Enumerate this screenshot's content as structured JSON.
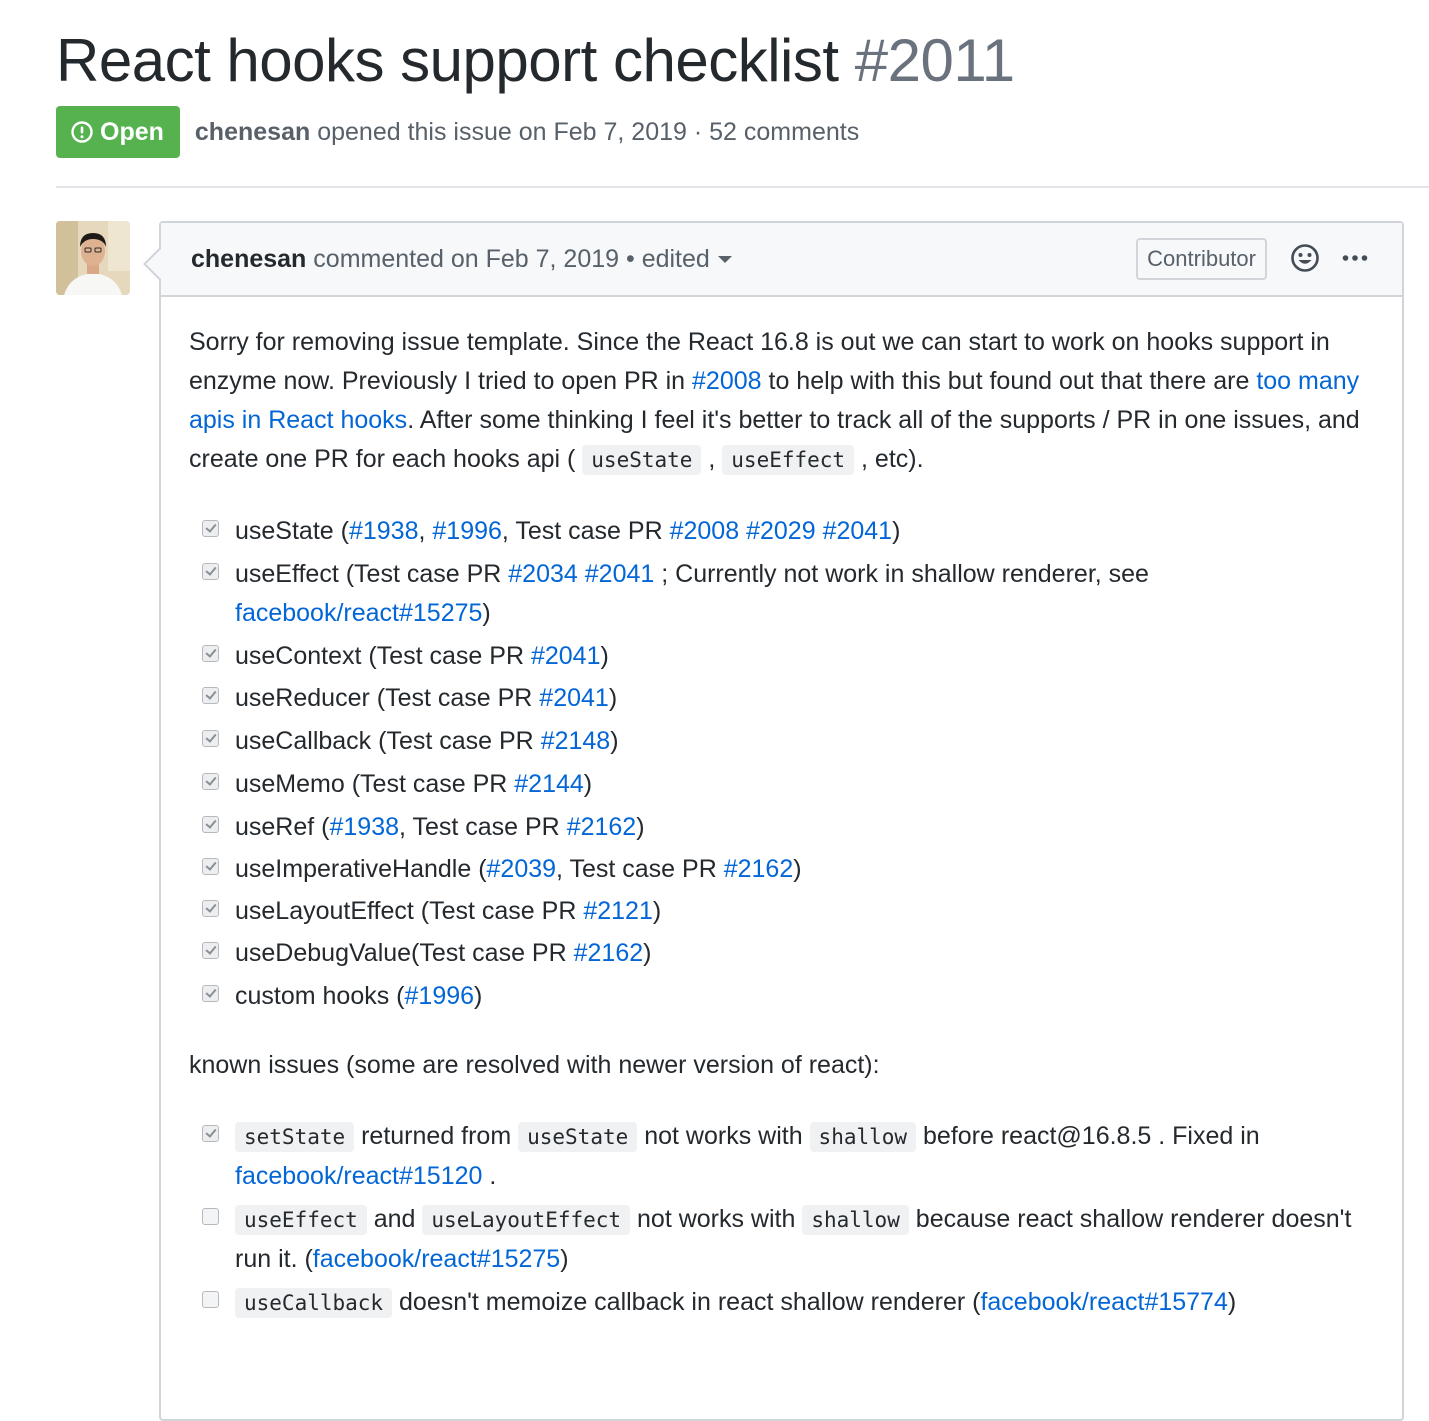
{
  "issue": {
    "title": "React hooks support checklist",
    "number": "#2011",
    "status": "Open",
    "author": "chenesan",
    "opened_text": "opened this issue on Feb 7, 2019 · 52 comments"
  },
  "comment": {
    "author": "chenesan",
    "timestamp": "commented on Feb 7, 2019 • edited",
    "role_badge": "Contributor",
    "intro": {
      "t1": "Sorry for removing issue template. Since the React 16.8 is out we can start to work on hooks support in enzyme now. Previously I tried to open PR in ",
      "l1": "#2008",
      "t2": " to help with this but found out that there are ",
      "l2": "too many apis in React hooks",
      "t3": ". After some thinking I feel it's better to track all of the supports / PR in one issues, and create one PR for each hooks api ( ",
      "c1": "useState",
      "t4": " , ",
      "c2": "useEffect",
      "t5": " , etc)."
    },
    "checklist": [
      {
        "checked": true,
        "parts": [
          {
            "t": "useState ("
          },
          {
            "l": "#1938"
          },
          {
            "t": ", "
          },
          {
            "l": "#1996"
          },
          {
            "t": ", Test case PR "
          },
          {
            "l": "#2008"
          },
          {
            "t": " "
          },
          {
            "l": "#2029"
          },
          {
            "t": " "
          },
          {
            "l": "#2041"
          },
          {
            "t": ")"
          }
        ]
      },
      {
        "checked": true,
        "parts": [
          {
            "t": "useEffect (Test case PR "
          },
          {
            "l": "#2034"
          },
          {
            "t": " "
          },
          {
            "l": "#2041"
          },
          {
            "t": " ; Currently not work in shallow renderer, see "
          },
          {
            "l": "facebook/react#15275"
          },
          {
            "t": ")"
          }
        ]
      },
      {
        "checked": true,
        "parts": [
          {
            "t": "useContext (Test case PR "
          },
          {
            "l": "#2041"
          },
          {
            "t": ")"
          }
        ]
      },
      {
        "checked": true,
        "parts": [
          {
            "t": "useReducer (Test case PR "
          },
          {
            "l": "#2041"
          },
          {
            "t": ")"
          }
        ]
      },
      {
        "checked": true,
        "parts": [
          {
            "t": "useCallback (Test case PR "
          },
          {
            "l": "#2148"
          },
          {
            "t": ")"
          }
        ]
      },
      {
        "checked": true,
        "parts": [
          {
            "t": "useMemo (Test case PR "
          },
          {
            "l": "#2144"
          },
          {
            "t": ")"
          }
        ]
      },
      {
        "checked": true,
        "parts": [
          {
            "t": "useRef ("
          },
          {
            "l": "#1938"
          },
          {
            "t": ", Test case PR "
          },
          {
            "l": "#2162"
          },
          {
            "t": ")"
          }
        ]
      },
      {
        "checked": true,
        "parts": [
          {
            "t": "useImperativeHandle ("
          },
          {
            "l": "#2039"
          },
          {
            "t": ", Test case PR "
          },
          {
            "l": "#2162"
          },
          {
            "t": ")"
          }
        ]
      },
      {
        "checked": true,
        "parts": [
          {
            "t": "useLayoutEffect (Test case PR "
          },
          {
            "l": "#2121"
          },
          {
            "t": ")"
          }
        ]
      },
      {
        "checked": true,
        "parts": [
          {
            "t": "useDebugValue(Test case PR "
          },
          {
            "l": "#2162"
          },
          {
            "t": ")"
          }
        ]
      },
      {
        "checked": true,
        "parts": [
          {
            "t": "custom hooks ("
          },
          {
            "l": "#1996"
          },
          {
            "t": ")"
          }
        ]
      }
    ],
    "known_issues_heading": "known issues (some are resolved with newer version of react):",
    "known_issues": [
      {
        "checked": true,
        "parts": [
          {
            "c": "setState"
          },
          {
            "t": " returned from "
          },
          {
            "c": "useState"
          },
          {
            "t": " not works with "
          },
          {
            "c": "shallow"
          },
          {
            "t": " before react@16.8.5 . Fixed in "
          },
          {
            "l": "facebook/react#15120"
          },
          {
            "t": " ."
          }
        ]
      },
      {
        "checked": false,
        "parts": [
          {
            "c": "useEffect"
          },
          {
            "t": " and "
          },
          {
            "c": "useLayoutEffect"
          },
          {
            "t": " not works with "
          },
          {
            "c": "shallow"
          },
          {
            "t": " because react shallow renderer doesn't run it. ("
          },
          {
            "l": "facebook/react#15275"
          },
          {
            "t": ")"
          }
        ]
      },
      {
        "checked": false,
        "parts": [
          {
            "c": "useCallback"
          },
          {
            "t": " doesn't memoize callback in react shallow renderer ("
          },
          {
            "l": "facebook/react#15774"
          },
          {
            "t": ")"
          }
        ]
      }
    ]
  }
}
